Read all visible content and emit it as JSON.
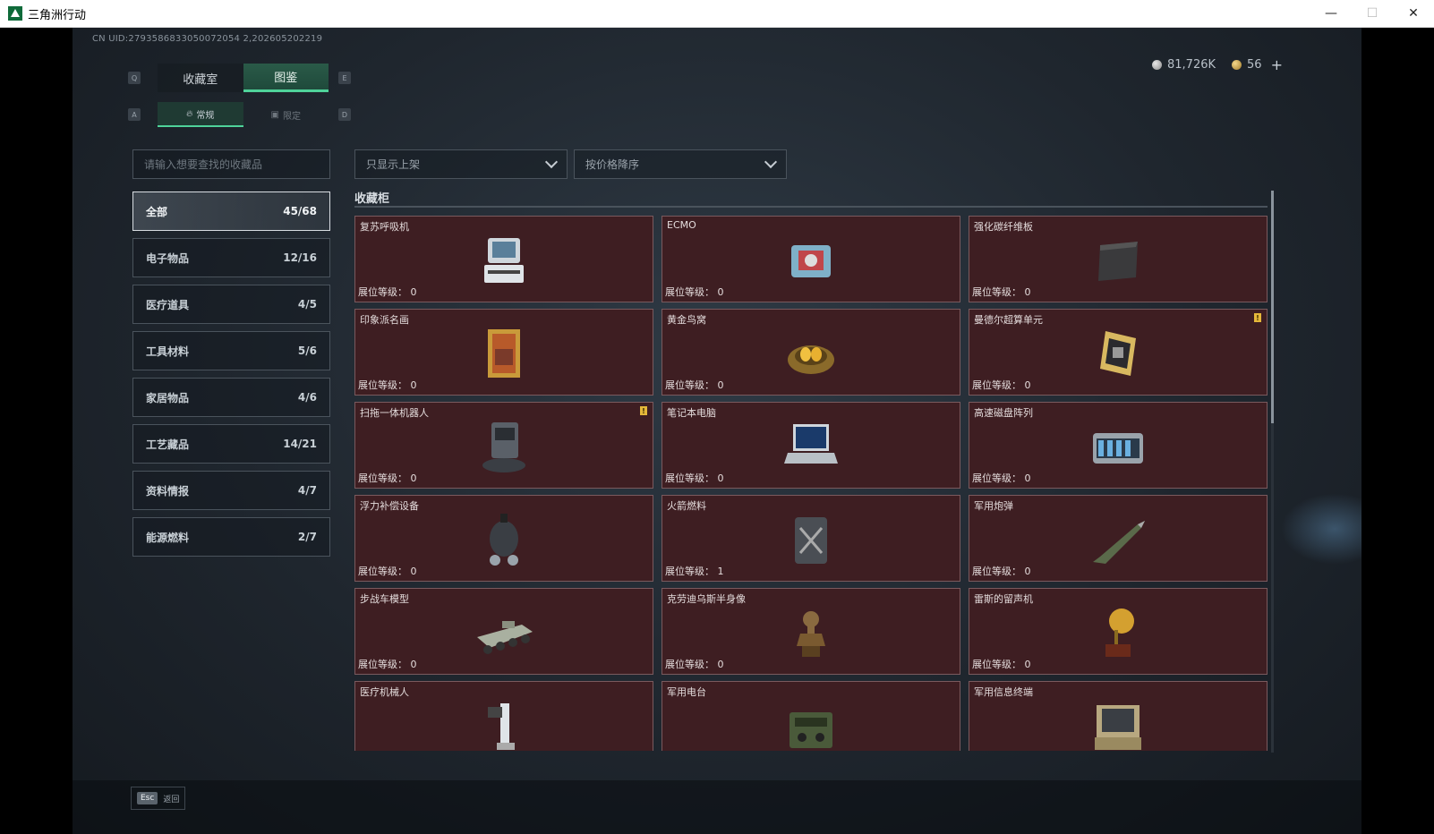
{
  "window": {
    "title": "三角洲行动",
    "minimize": "—",
    "maximize": "☐",
    "close": "✕"
  },
  "header": {
    "uid": "CN UID:2793586833050072054 2,202605202219",
    "silver_amount": "81,726K",
    "gold_amount": "56",
    "add_label": "+"
  },
  "key_hints": {
    "tab_left": "Q",
    "tab_right": "E",
    "subtab_left": "A",
    "subtab_right": "D"
  },
  "tabs": [
    {
      "label": "收藏室"
    },
    {
      "label": "图鉴"
    }
  ],
  "subtabs": [
    {
      "label": "常规",
      "icon": "flame-icon"
    },
    {
      "label": "限定",
      "icon": "card-icon"
    }
  ],
  "search": {
    "placeholder": "请输入想要查找的收藏品"
  },
  "categories": [
    {
      "label": "全部",
      "count": "45/68"
    },
    {
      "label": "电子物品",
      "count": "12/16"
    },
    {
      "label": "医疗道具",
      "count": "4/5"
    },
    {
      "label": "工具材料",
      "count": "5/6"
    },
    {
      "label": "家居物品",
      "count": "4/6"
    },
    {
      "label": "工艺藏品",
      "count": "14/21"
    },
    {
      "label": "资料情报",
      "count": "4/7"
    },
    {
      "label": "能源燃料",
      "count": "2/7"
    }
  ],
  "filters": {
    "display_filter": "只显示上架",
    "sort": "按价格降序"
  },
  "section": {
    "title": "收藏柜"
  },
  "level_label": "展位等级：",
  "items": [
    {
      "name": "复苏呼吸机",
      "level": "0",
      "icon": "ventilator-icon",
      "warn": false
    },
    {
      "name": "ECMO",
      "level": "0",
      "icon": "ecmo-icon",
      "warn": false
    },
    {
      "name": "强化碳纤维板",
      "level": "0",
      "icon": "carbon-plate-icon",
      "warn": false
    },
    {
      "name": "印象派名画",
      "level": "0",
      "icon": "painting-icon",
      "warn": false
    },
    {
      "name": "黄金鸟窝",
      "level": "0",
      "icon": "golden-nest-icon",
      "warn": false
    },
    {
      "name": "曼德尔超算单元",
      "level": "0",
      "icon": "compute-unit-icon",
      "warn": true
    },
    {
      "name": "扫拖一体机器人",
      "level": "0",
      "icon": "robot-vacuum-icon",
      "warn": true
    },
    {
      "name": "笔记本电脑",
      "level": "0",
      "icon": "laptop-icon",
      "warn": false
    },
    {
      "name": "高速磁盘阵列",
      "level": "0",
      "icon": "disk-array-icon",
      "warn": false
    },
    {
      "name": "浮力补偿设备",
      "level": "0",
      "icon": "buoyancy-device-icon",
      "warn": false
    },
    {
      "name": "火箭燃料",
      "level": "1",
      "icon": "fuel-can-icon",
      "warn": false
    },
    {
      "name": "军用炮弹",
      "level": "0",
      "icon": "artillery-shell-icon",
      "warn": false
    },
    {
      "name": "步战车模型",
      "level": "0",
      "icon": "ifv-model-icon",
      "warn": false
    },
    {
      "name": "克劳迪乌斯半身像",
      "level": "0",
      "icon": "bust-icon",
      "warn": false
    },
    {
      "name": "雷斯的留声机",
      "level": "0",
      "icon": "gramophone-icon",
      "warn": false
    },
    {
      "name": "医疗机械人",
      "level": "",
      "icon": "medical-robot-icon",
      "warn": false
    },
    {
      "name": "军用电台",
      "level": "",
      "icon": "military-radio-icon",
      "warn": false
    },
    {
      "name": "军用信息终端",
      "level": "",
      "icon": "info-terminal-icon",
      "warn": false
    }
  ],
  "footer": {
    "esc_key": "Esc",
    "back_label": "返回"
  },
  "colors": {
    "accent": "#4fd39a",
    "card_bg": "#3e1e22",
    "warn": "#e5b83a"
  }
}
